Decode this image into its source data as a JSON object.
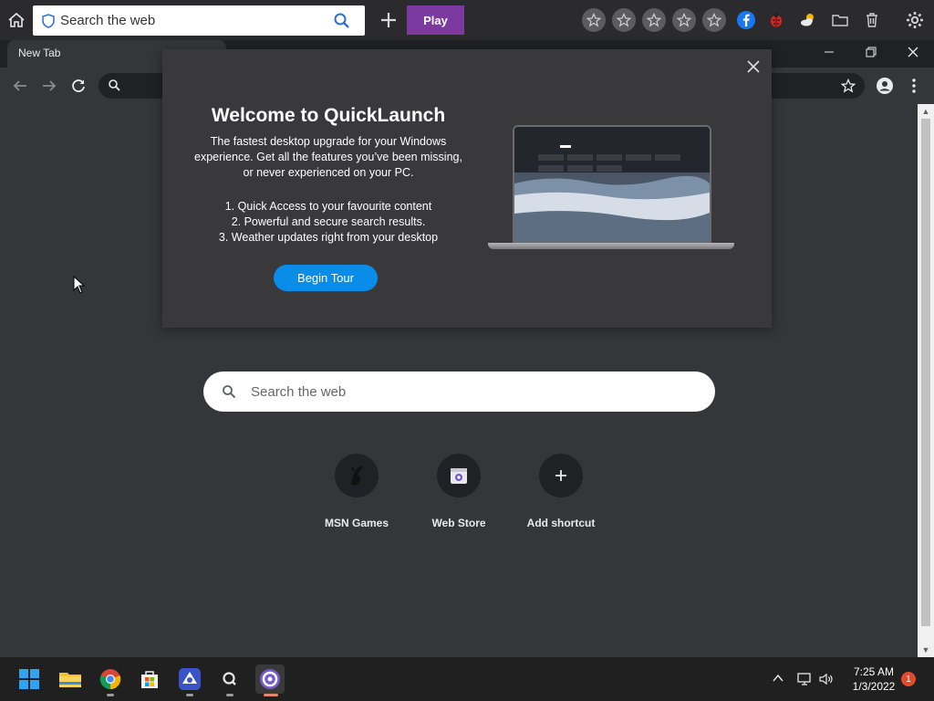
{
  "quicklaunch_bar": {
    "search_placeholder": "Search the web",
    "play_label": "Play",
    "star_slots": [
      "star-1",
      "star-2",
      "star-3",
      "star-4",
      "star-5"
    ],
    "icons": [
      "facebook-icon",
      "ladybug-icon",
      "weather-icon",
      "folder-icon",
      "trash-icon",
      "gear-icon"
    ],
    "accent": "#7c3aa0"
  },
  "browser": {
    "tab_title": "New Tab"
  },
  "modal": {
    "title": "Welcome to QuickLaunch",
    "description_lines": [
      "The fastest desktop upgrade for your Windows",
      "experience. Get all the features you’ve been missing,",
      "or never experienced on your PC."
    ],
    "features": [
      "1. Quick Access to your favourite content",
      "2. Powerful and secure search results.",
      "3. Weather updates right from your desktop"
    ],
    "cta_label": "Begin Tour",
    "cta_color": "#0a8de8"
  },
  "ntp": {
    "search_placeholder": "Search the web",
    "shortcuts": [
      {
        "label": "MSN Games",
        "icon": "msn-games-icon"
      },
      {
        "label": "Web Store",
        "icon": "web-store-icon"
      },
      {
        "label": "Add shortcut",
        "icon": "plus-icon"
      }
    ]
  },
  "taskbar": {
    "apps": [
      "windows-start-icon",
      "file-explorer-icon",
      "chrome-icon",
      "microsoft-store-icon",
      "app-icon",
      "search-app-icon",
      "quicklaunch-icon"
    ],
    "time": "7:25 AM",
    "date": "1/3/2022",
    "notification_count": "1"
  }
}
